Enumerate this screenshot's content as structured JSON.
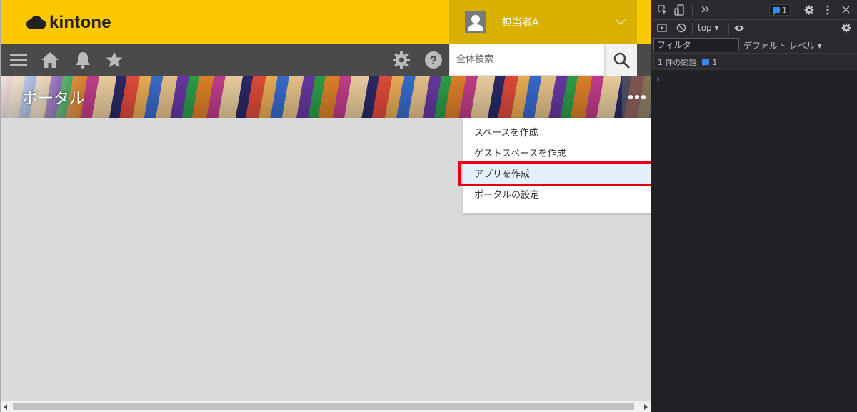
{
  "app": {
    "logo_text": "kintone",
    "user_name": "担当者A",
    "search_placeholder": "全体検索",
    "portal_title": "ポータル",
    "menu_items": [
      "スペースを作成",
      "ゲストスペースを作成",
      "アプリを作成",
      "ポータルの設定"
    ],
    "highlighted_menu_index": 2
  },
  "devtools": {
    "issues_badge_count": "1",
    "context": "top",
    "filter_placeholder": "フィルタ",
    "level_label": "デフォルト レベル",
    "issues_text": "1 件の問題:",
    "issues_count": "1",
    "prompt": "›"
  },
  "colors": {
    "header_yellow": "#fcc800",
    "user_area_yellow": "#d9af00",
    "navbar": "#4a4a4a",
    "highlight_red": "#e60012",
    "devtools_bg": "#202124"
  }
}
